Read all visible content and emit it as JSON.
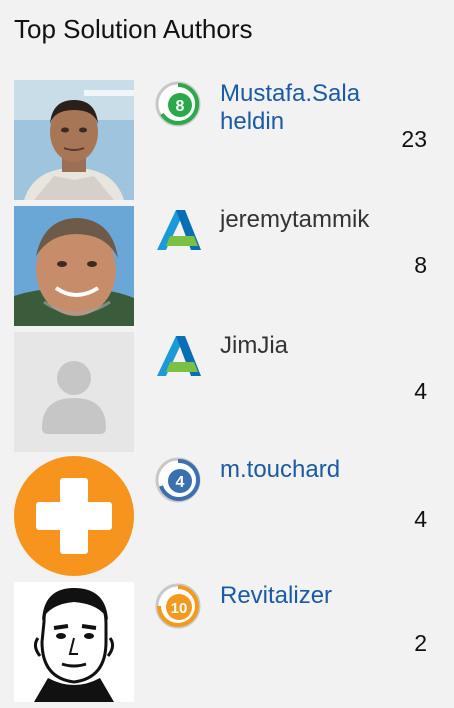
{
  "widget": {
    "title": "Top Solution Authors",
    "authors": [
      {
        "name": "Mustafa.Salaheldin",
        "rank_badge": "8",
        "rank_icon": "rank-8-icon",
        "count": "23",
        "avatar": "photo-man-dark-hair"
      },
      {
        "name": "jeremytammik",
        "rank_badge": "",
        "rank_icon": "autodesk-employee-icon",
        "count": "8",
        "avatar": "photo-man-smiling"
      },
      {
        "name": "JimJia",
        "rank_badge": "",
        "rank_icon": "autodesk-employee-icon",
        "count": "4",
        "avatar": "default-user-avatar"
      },
      {
        "name": "m.touchard",
        "rank_badge": "4",
        "rank_icon": "rank-4-icon",
        "count": "4",
        "avatar": "orange-plus-avatar"
      },
      {
        "name": "Revitalizer",
        "rank_badge": "10",
        "rank_icon": "rank-10-icon",
        "count": "2",
        "avatar": "sketch-face-avatar"
      }
    ]
  },
  "colors": {
    "link": "#1a5aa6",
    "plain_text": "#333333",
    "background": "#f2f2f2",
    "rank8_green": "#2aa84a",
    "rank4_blue": "#3a6fb0",
    "rank10_orange": "#f39a1e",
    "avatar_orange": "#f7941d"
  }
}
